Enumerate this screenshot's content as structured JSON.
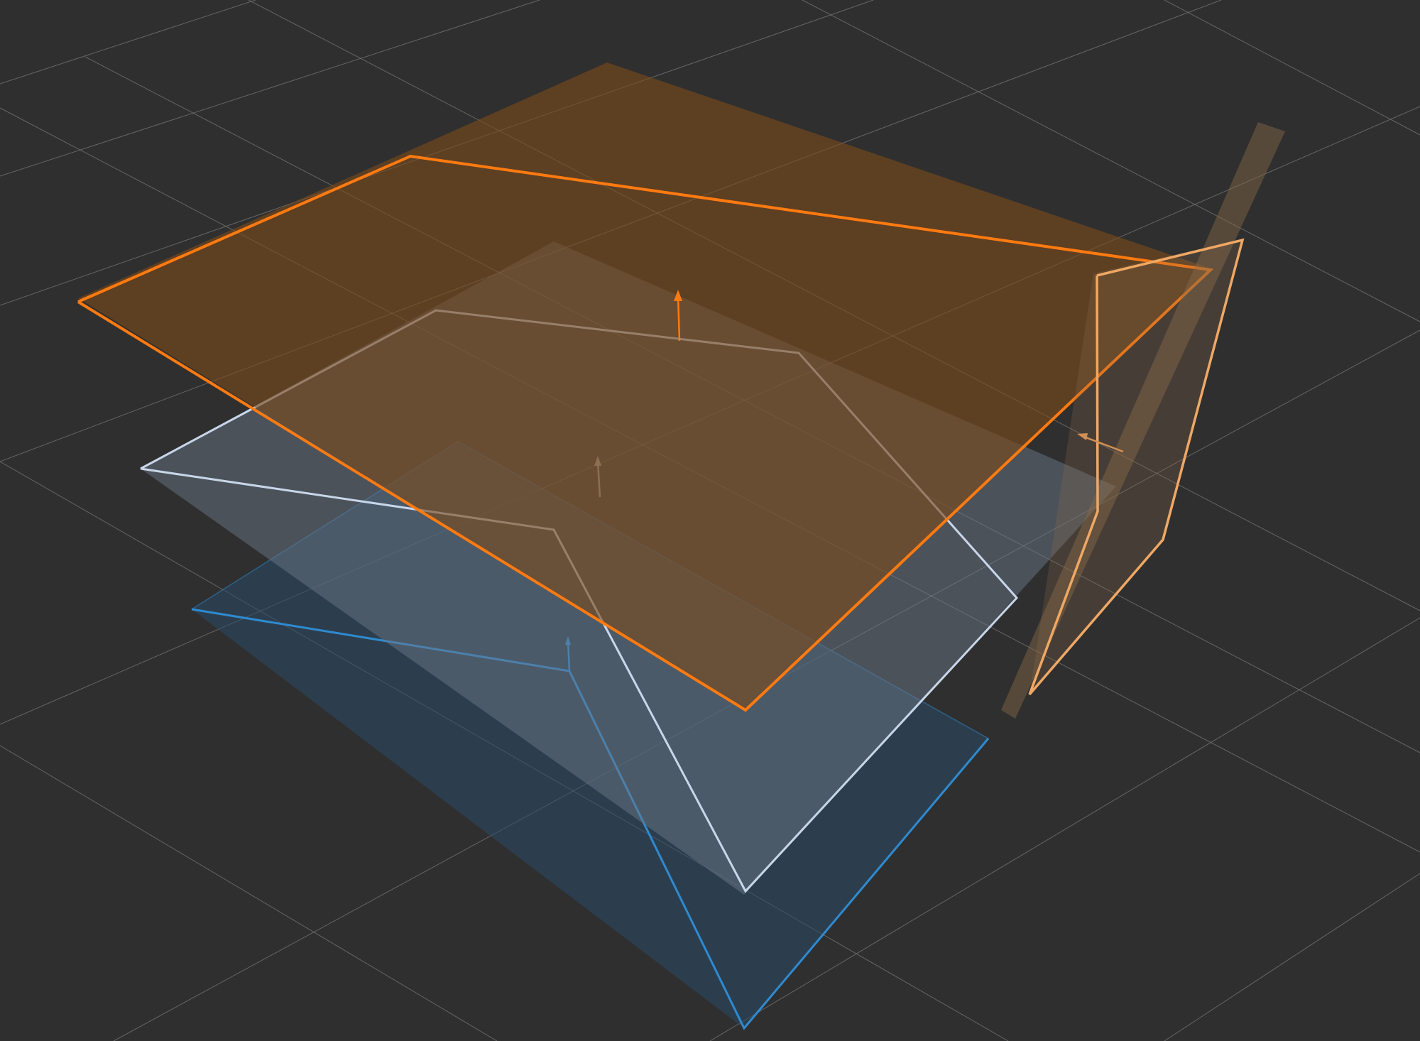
{
  "viewport": {
    "background": "#2f2f2f",
    "grid_color": "#777777"
  },
  "planes": [
    {
      "name": "lower-blue-plane",
      "fill": "#2a4a66",
      "outline": "#2f8ad0"
    },
    {
      "name": "middle-light-plane",
      "fill": "#5f6a78",
      "outline": "#b9c8de"
    },
    {
      "name": "upper-orange-plane",
      "fill": "#7a4a1c",
      "outline": "#ff7a10"
    },
    {
      "name": "vertical-orange-plane",
      "fill": "#8a6a4a",
      "outline": "#f0a864"
    }
  ],
  "icons": {
    "normal_arrow": "normal-arrow-icon"
  }
}
